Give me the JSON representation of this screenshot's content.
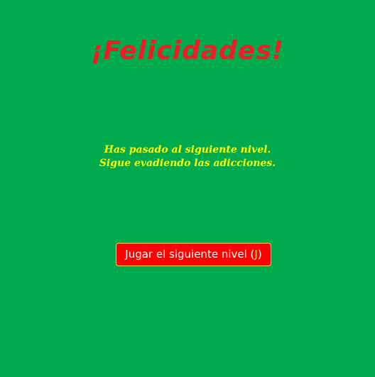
{
  "screen": {
    "title": "¡Felicidades!",
    "message_line_1": "Has pasado al siguiente nivel.",
    "message_line_2": "Sigue evadiendo las adicciones."
  },
  "next_button": {
    "label": "Jugar el siguiente nivel",
    "paren_open": "(",
    "shortcut_key": "J",
    "paren_close": ")"
  },
  "colors": {
    "background": "#00ab4e",
    "title": "#ee1c25",
    "message": "#ffff00",
    "button_bg": "#ff0000",
    "button_text": "#ffffff",
    "shortcut": "#ffd23f"
  }
}
